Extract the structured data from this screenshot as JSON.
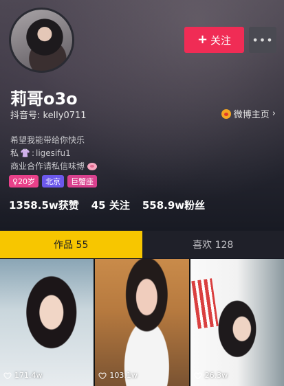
{
  "profile": {
    "name": "莉哥o3o",
    "douyin_id": "抖音号: kelly0711",
    "weibo_link": "微博主页",
    "follow_label": "关注",
    "more_label": "•••",
    "bio_lines": [
      "希望我能带给你快乐",
      "ligesifu1",
      "商业合作请私信味博"
    ],
    "bio_private_prefix": "私",
    "tags": [
      "20岁",
      "北京",
      "巨蟹座"
    ],
    "stats": {
      "likes": "1358.5w获赞",
      "following": "45 关注",
      "followers": "558.9w粉丝"
    },
    "colors": {
      "follow": "#f02c55",
      "tab_active": "#f7c600",
      "tag_age": "#e9418a",
      "tag_city": "#6c58ec"
    }
  },
  "tabs": [
    {
      "label": "作品 55",
      "active": true
    },
    {
      "label": "喜欢 128",
      "active": false
    }
  ],
  "videos": [
    {
      "likes": "171.4w",
      "icon": "heart-icon"
    },
    {
      "likes": "103.1w",
      "icon": "heart-icon"
    },
    {
      "likes": "26.3w",
      "icon": "heart-icon"
    }
  ]
}
